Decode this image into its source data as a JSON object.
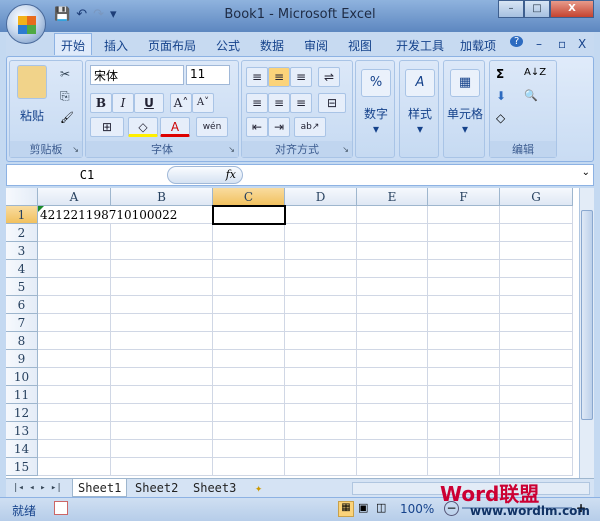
{
  "window": {
    "title": "Book1 - Microsoft Excel",
    "minimize": "–",
    "maximize": "□",
    "close": "X"
  },
  "qat": {
    "save": "💾",
    "undo": "↶",
    "redo": "↷",
    "customize": "▾"
  },
  "tabs": [
    "开始",
    "插入",
    "页面布局",
    "公式",
    "数据",
    "审阅",
    "视图",
    "开发工具",
    "加载项"
  ],
  "ribbon_right": {
    "help": "?",
    "min": "–",
    "restore": "▫",
    "close": "X"
  },
  "clipboard": {
    "label": "剪贴板",
    "paste": "粘贴",
    "cut": "✂",
    "copy": "⎘",
    "format_painter": "🖌"
  },
  "font": {
    "label": "字体",
    "name": "宋体",
    "size": "11",
    "bold": "B",
    "italic": "I",
    "underline": "U",
    "grow": "A˄",
    "shrink": "A˅",
    "border": "⊞",
    "fill": "◇",
    "color": "A",
    "phonetic": "wén"
  },
  "alignment": {
    "label": "对齐方式",
    "top": "≡",
    "middle": "≡",
    "bottom": "≡",
    "wrap": "⇌",
    "left": "≡",
    "center": "≡",
    "right": "≡",
    "merge": "⊟",
    "decrease_indent": "⇤",
    "increase_indent": "⇥",
    "orientation": "ab↗"
  },
  "number": {
    "label": "数字",
    "icon": "%"
  },
  "styles": {
    "label": "样式",
    "icon": "A"
  },
  "cells": {
    "label": "单元格",
    "icon": "▦"
  },
  "editing": {
    "label": "编辑",
    "sum": "Σ",
    "sort": "A↓Z",
    "fill": "⬇",
    "find": "🔍",
    "clear": "◇"
  },
  "formula_bar": {
    "name_box": "C1",
    "fx": "fx",
    "value": ""
  },
  "columns": [
    "A",
    "B",
    "C",
    "D",
    "E",
    "F",
    "G"
  ],
  "rows": [
    "1",
    "2",
    "3",
    "4",
    "5",
    "6",
    "7",
    "8",
    "9",
    "10",
    "11",
    "12",
    "13",
    "14",
    "15"
  ],
  "cells_data": {
    "A1": "421221198710100022"
  },
  "active_cell": "C1",
  "sheets": [
    "Sheet1",
    "Sheet2",
    "Sheet3"
  ],
  "status": {
    "ready": "就绪",
    "zoom": "100%",
    "zoom_out": "−",
    "zoom_in": "+"
  },
  "watermark": {
    "text": "Word联盟",
    "url": "www.wordlm.com"
  }
}
